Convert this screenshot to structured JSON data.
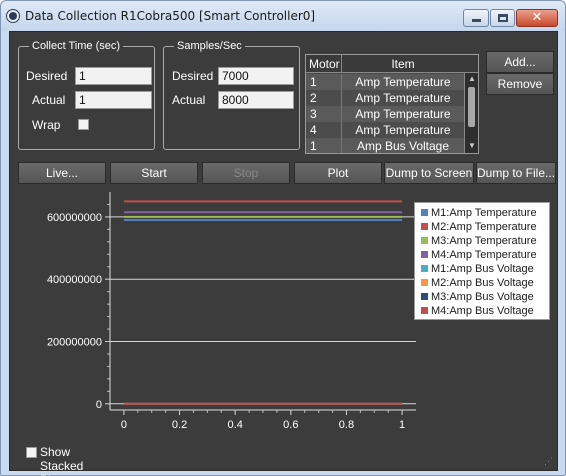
{
  "window": {
    "title": "Data Collection R1Cobra500 [Smart Controller0]",
    "close_glyph": "✕"
  },
  "collect_time": {
    "legend": "Collect Time (sec)",
    "desired_label": "Desired",
    "desired_value": "1",
    "actual_label": "Actual",
    "actual_value": "1",
    "wrap_label": "Wrap",
    "wrap_checked": false
  },
  "samples": {
    "legend": "Samples/Sec",
    "desired_label": "Desired",
    "desired_value": "7000",
    "actual_label": "Actual",
    "actual_value": "8000"
  },
  "item_grid": {
    "columns": [
      "Motor",
      "Item"
    ],
    "rows": [
      {
        "motor": "1",
        "item": "Amp Temperature"
      },
      {
        "motor": "2",
        "item": "Amp Temperature"
      },
      {
        "motor": "3",
        "item": "Amp Temperature"
      },
      {
        "motor": "4",
        "item": "Amp Temperature"
      },
      {
        "motor": "1",
        "item": "Amp Bus Voltage"
      }
    ],
    "scroll_up": "▲",
    "scroll_down": "▼"
  },
  "side_buttons": {
    "add": "Add...",
    "remove": "Remove"
  },
  "toolbar": {
    "live": "Live...",
    "start": "Start",
    "stop": "Stop",
    "plot": "Plot",
    "dump_screen": "Dump to Screen",
    "dump_file": "Dump to File..."
  },
  "chart_data": {
    "type": "line",
    "x": [
      0,
      1
    ],
    "xticks": [
      "0",
      "0.2",
      "0.4",
      "0.6",
      "0.8",
      "1"
    ],
    "yticks": [
      "0",
      "200000000",
      "400000000",
      "600000000"
    ],
    "xlim": [
      -0.05,
      1.05
    ],
    "ylim": [
      -20000000,
      680000000
    ],
    "grid": true,
    "legend_placement": "top-right",
    "series": [
      {
        "name": "M1:Amp Temperature",
        "color": "#4f81bd",
        "values": [
          590000000,
          590000000
        ]
      },
      {
        "name": "M2:Amp Temperature",
        "color": "#c0504d",
        "values": [
          650000000,
          650000000
        ]
      },
      {
        "name": "M3:Amp Temperature",
        "color": "#9bbb59",
        "values": [
          600000000,
          600000000
        ]
      },
      {
        "name": "M4:Amp Temperature",
        "color": "#8064a2",
        "values": [
          615000000,
          615000000
        ]
      },
      {
        "name": "M1:Amp Bus Voltage",
        "color": "#4bacc6",
        "values": [
          0,
          0
        ]
      },
      {
        "name": "M2:Amp Bus Voltage",
        "color": "#f79646",
        "values": [
          0,
          0
        ]
      },
      {
        "name": "M3:Amp Bus Voltage",
        "color": "#2c4d75",
        "values": [
          0,
          0
        ]
      },
      {
        "name": "M4:Amp Bus Voltage",
        "color": "#c0504d",
        "values": [
          0,
          0
        ]
      }
    ]
  },
  "footer": {
    "show_stacked_label": "Show Stacked Plots",
    "show_stacked_checked": false,
    "resize_grip": "⋰"
  }
}
